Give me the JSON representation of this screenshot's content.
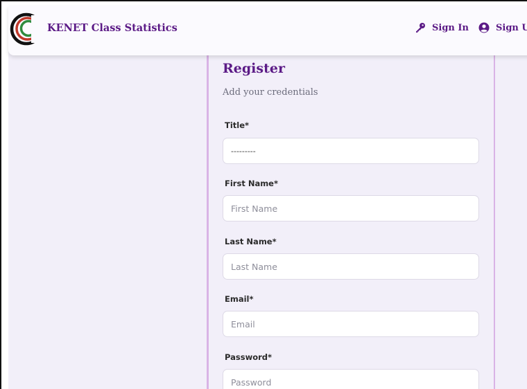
{
  "brand": {
    "name": "KENET Class Statistics"
  },
  "nav": {
    "signin_label": "Sign In",
    "signup_label": "Sign Up"
  },
  "form": {
    "title": "Register",
    "subtitle": "Add your credentials",
    "fields": [
      {
        "label": "Title*",
        "value": "---------"
      },
      {
        "label": "First Name*",
        "placeholder": "First Name"
      },
      {
        "label": "Last Name*",
        "placeholder": "Last Name"
      },
      {
        "label": "Email*",
        "placeholder": "Email"
      },
      {
        "label": "Password*",
        "placeholder": "Password"
      }
    ]
  },
  "colors": {
    "brand": "#5b1a86",
    "accent_border": "#d9b3e6",
    "background": "#f2eff9"
  },
  "icons": {
    "signin": "key-icon",
    "signup": "user-circle-icon",
    "logo": "kenet-rings-logo"
  }
}
